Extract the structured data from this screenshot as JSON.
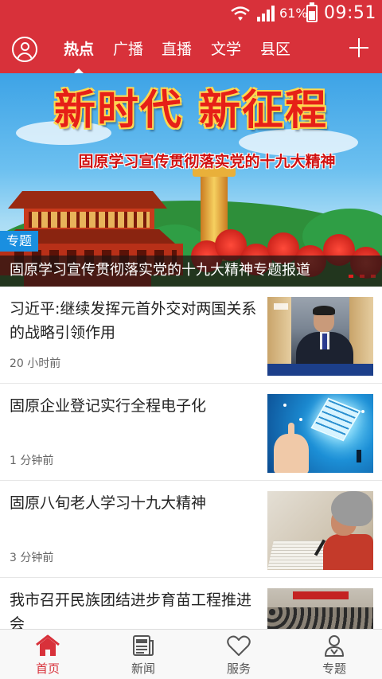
{
  "status_bar": {
    "battery_percent": "61%",
    "time": "09:51",
    "icons": [
      "wifi-icon",
      "signal-icon",
      "battery-icon"
    ]
  },
  "top_nav": {
    "tabs": [
      {
        "label": "热点",
        "active": true
      },
      {
        "label": "广播",
        "active": false
      },
      {
        "label": "直播",
        "active": false
      },
      {
        "label": "文学",
        "active": false
      },
      {
        "label": "县区",
        "active": false
      }
    ],
    "icons": [
      "user-avatar-icon",
      "plus-icon"
    ]
  },
  "banner": {
    "headline": "新时代  新征程",
    "subheadline": "固原学习宣传贯彻落实党的十九大精神",
    "badge": "专题",
    "caption": "固原学习宣传贯彻落实党的十九大精神专题报道",
    "slide_count": 3,
    "active_slide": 1
  },
  "news": [
    {
      "title": "习近平:继续发挥元首外交对两国关系的战略引领作用",
      "time": "20 小时前"
    },
    {
      "title": "固原企业登记实行全程电子化",
      "time": "1 分钟前"
    },
    {
      "title": "固原八旬老人学习十九大精神",
      "time": "3 分钟前"
    },
    {
      "title": "我市召开民族团结进步育苗工程推进会",
      "time": ""
    }
  ],
  "bottom_nav": {
    "items": [
      {
        "label": "首页",
        "icon": "home-icon",
        "active": true
      },
      {
        "label": "新闻",
        "icon": "news-icon",
        "active": false
      },
      {
        "label": "服务",
        "icon": "heart-icon",
        "active": false
      },
      {
        "label": "专题",
        "icon": "topic-people-icon",
        "active": false
      }
    ]
  },
  "colors": {
    "brand_red": "#d8313a",
    "badge_blue": "#1a8fe0",
    "text_dark": "#222222",
    "text_muted": "#666666"
  }
}
